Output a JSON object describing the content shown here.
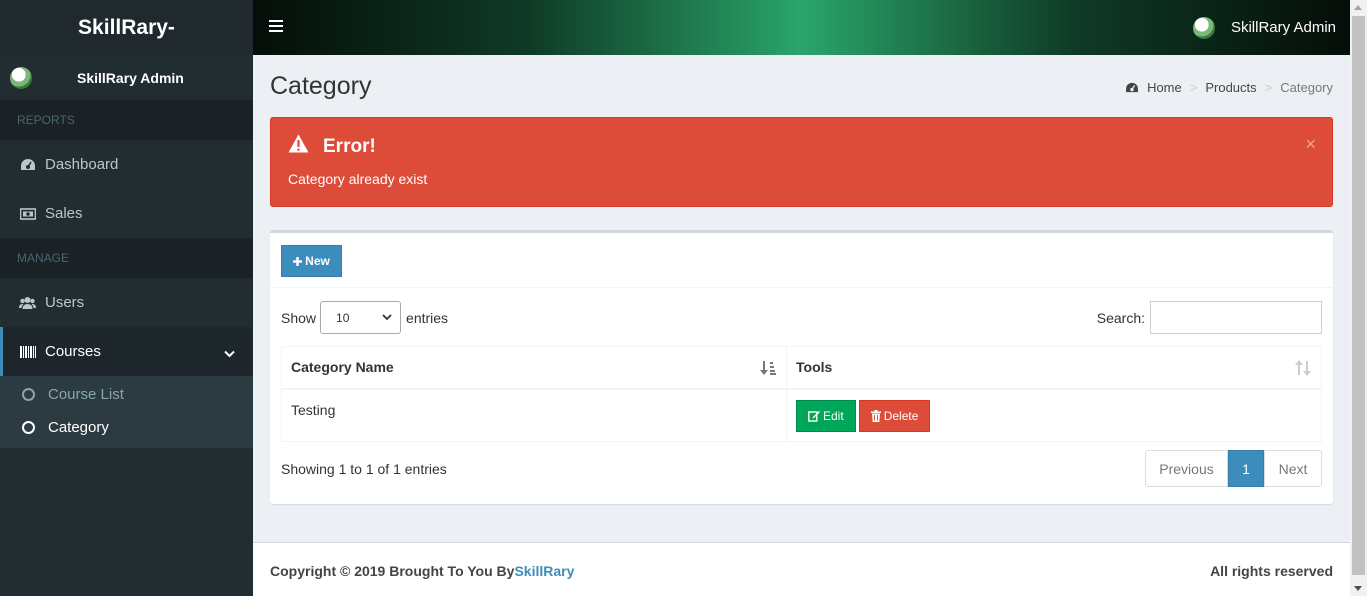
{
  "brand": "SkillRary-",
  "sidebar": {
    "user_name": "SkillRary Admin",
    "section_reports": "REPORTS",
    "section_manage": "MANAGE",
    "items": [
      {
        "label": "Dashboard",
        "icon": "dashboard-icon"
      },
      {
        "label": "Sales",
        "icon": "money-icon"
      },
      {
        "label": "Users",
        "icon": "users-icon"
      },
      {
        "label": "Courses",
        "icon": "barcode-icon"
      }
    ],
    "submenu": [
      {
        "label": "Course List"
      },
      {
        "label": "Category"
      }
    ]
  },
  "topbar": {
    "user_name": "SkillRary Admin"
  },
  "page": {
    "title": "Category",
    "breadcrumb": [
      "Home",
      "Products",
      "Category"
    ]
  },
  "alert": {
    "title": "Error!",
    "message": "Category already exist",
    "close": "×",
    "color": "#dd4b39"
  },
  "box": {
    "new_label": "New",
    "show_label": "Show",
    "entries_label": "entries",
    "page_length": "10",
    "search_label": "Search:",
    "search_value": "",
    "columns": [
      "Category Name",
      "Tools"
    ],
    "rows": [
      {
        "name": "Testing",
        "edit_label": "Edit",
        "delete_label": "Delete"
      }
    ],
    "info": "Showing 1 to 1 of 1 entries",
    "pagination": {
      "previous": "Previous",
      "current": "1",
      "next": "Next"
    }
  },
  "footer": {
    "copyright_prefix": "Copyright © 2019 Brought To You By",
    "copyright_link": "SkillRary",
    "rights": "All rights reserved"
  },
  "colors": {
    "accent": "#3c8dbc",
    "success": "#00a65a",
    "danger": "#dd4b39",
    "sidebar": "#222d32"
  }
}
